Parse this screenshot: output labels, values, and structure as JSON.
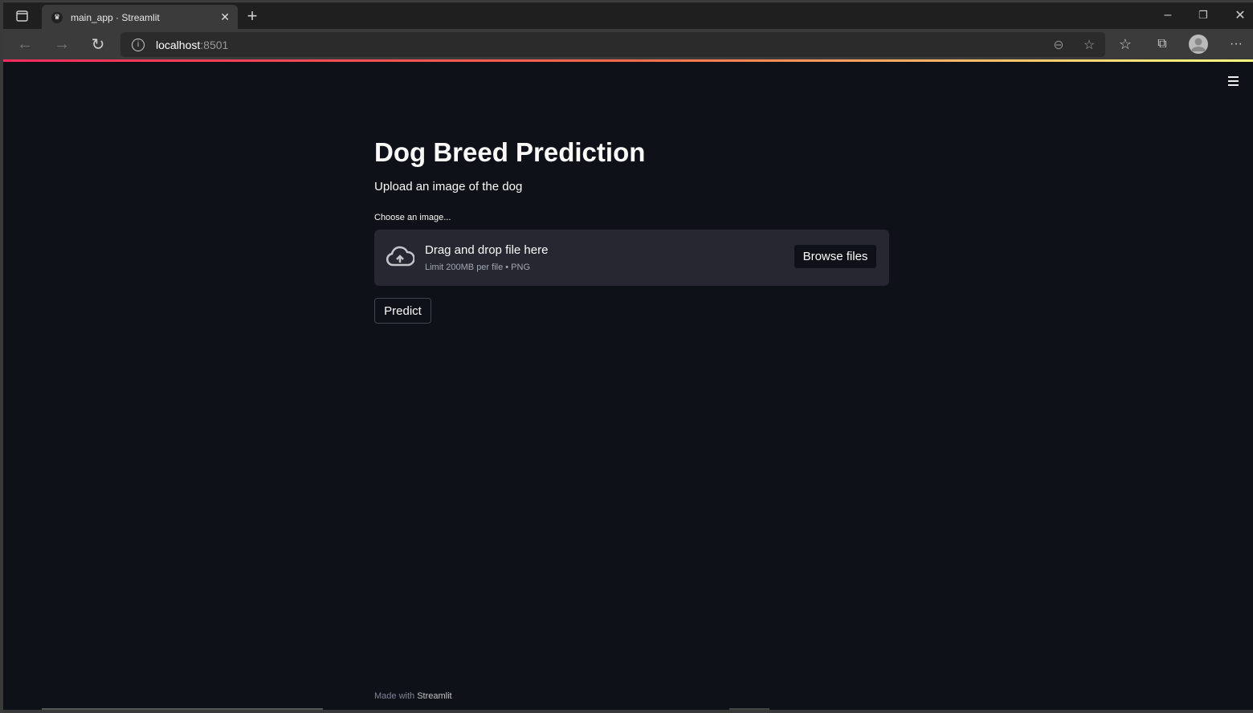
{
  "browser": {
    "tab_title": "main_app · Streamlit",
    "url_host": "localhost",
    "url_port": ":8501",
    "icons": [
      "sidebar-toggle-icon",
      "streamlit-favicon",
      "close-icon",
      "new-tab-icon",
      "back-icon",
      "forward-icon",
      "refresh-icon",
      "info-icon",
      "zoom-out-icon",
      "add-favorite-icon",
      "favorites-icon",
      "collections-icon",
      "profile-icon",
      "more-icon",
      "minimize-icon",
      "restore-icon",
      "window-close-icon"
    ]
  },
  "accent_gradient": [
    "#ff2b5f",
    "#fffd80"
  ],
  "app": {
    "title": "Dog Breed Prediction",
    "subtitle": "Upload an image of the dog",
    "uploader": {
      "label": "Choose an image...",
      "drag_text": "Drag and drop file here",
      "limit_text": "Limit 200MB per file • PNG",
      "browse_label": "Browse files"
    },
    "predict_label": "Predict",
    "footer_prefix": "Made with ",
    "footer_brand": "Streamlit"
  }
}
